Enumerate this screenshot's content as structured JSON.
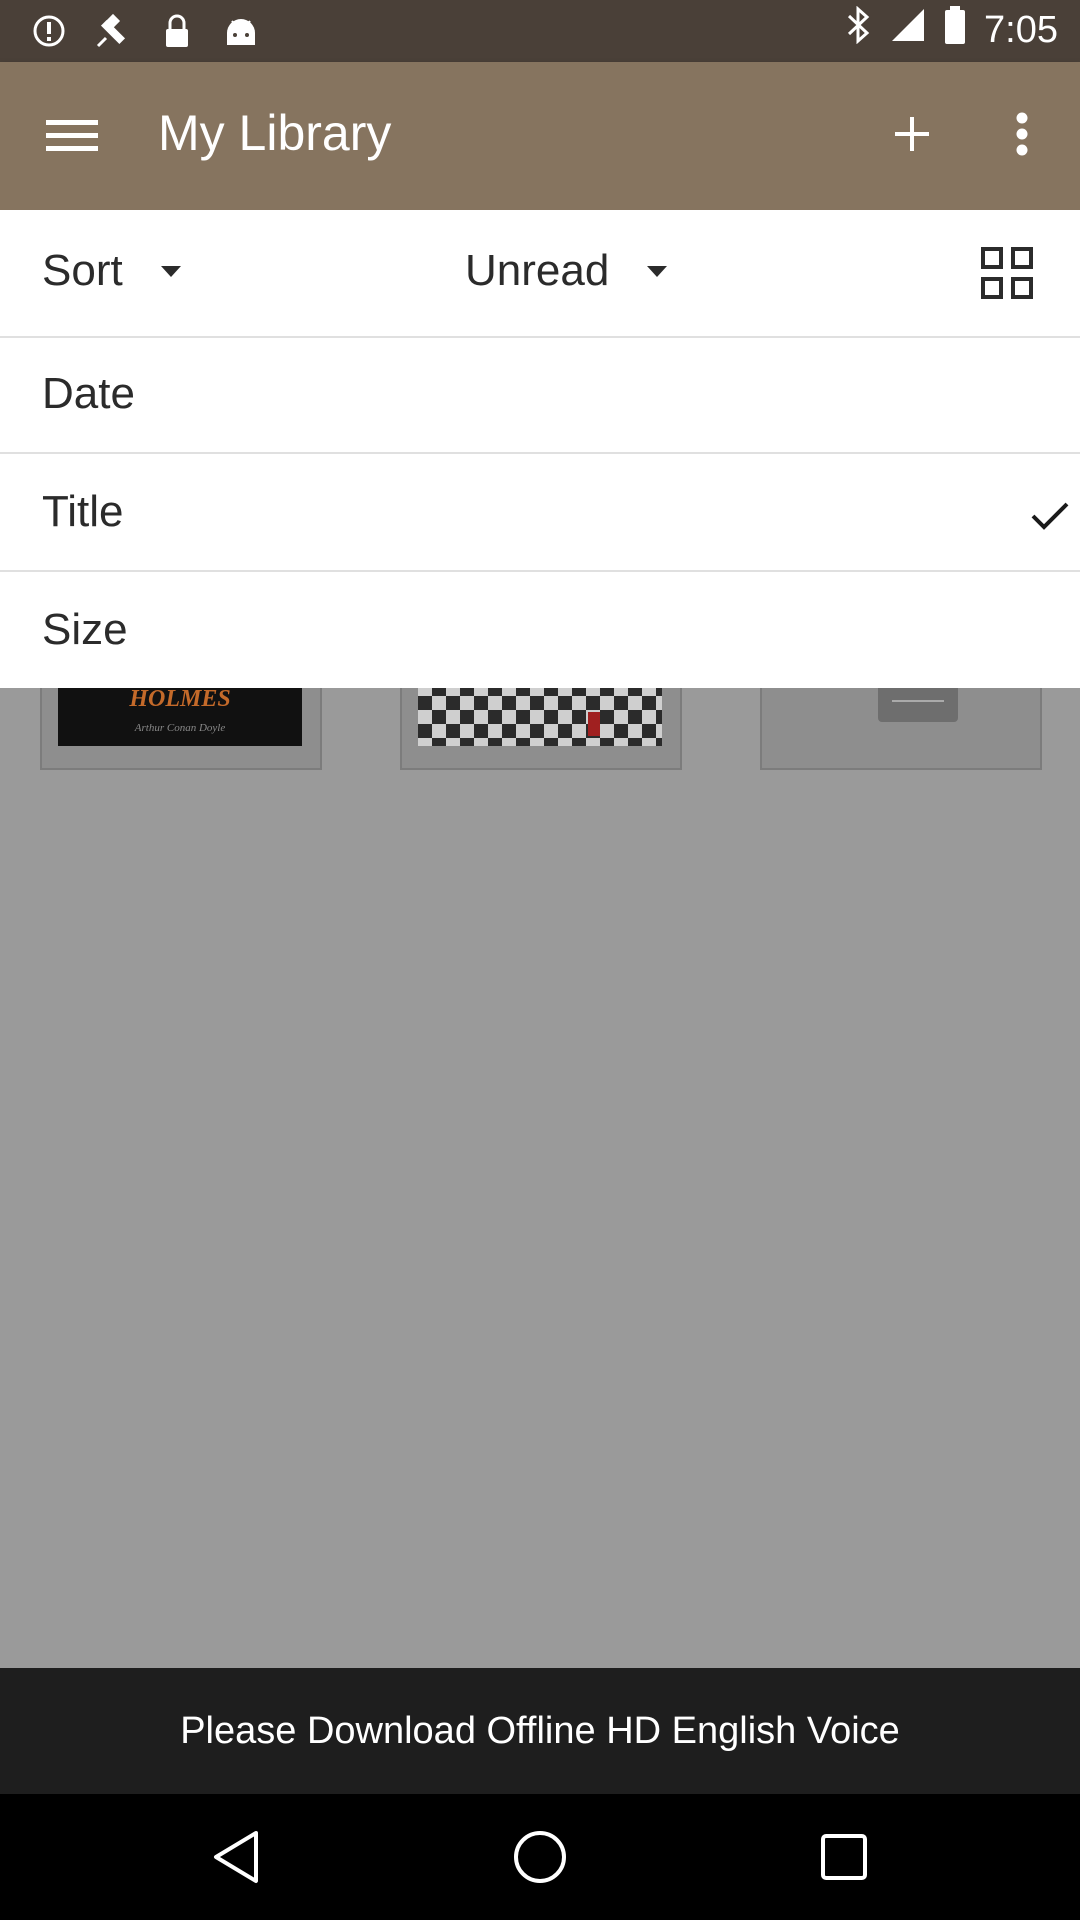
{
  "status_bar": {
    "time": "7:05",
    "icons": [
      "alert-icon",
      "satellite-icon",
      "lock-icon",
      "android-icon",
      "bluetooth-icon",
      "signal-icon",
      "battery-icon"
    ]
  },
  "app_bar": {
    "title": "My Library",
    "background": "#86745f"
  },
  "filters": {
    "sort_label": "Sort",
    "status_label": "Unread"
  },
  "sort_options": [
    {
      "label": "Date",
      "selected": false
    },
    {
      "label": "Title",
      "selected": true
    },
    {
      "label": "Size",
      "selected": false
    }
  ],
  "books": [
    {
      "cover_text": "HOLMES",
      "cover_subtext": "Arthur Conan Doyle"
    },
    {
      "cover_text": ""
    },
    {
      "cover_text": ""
    }
  ],
  "banner": {
    "text": "Please Download Offline HD English Voice"
  }
}
